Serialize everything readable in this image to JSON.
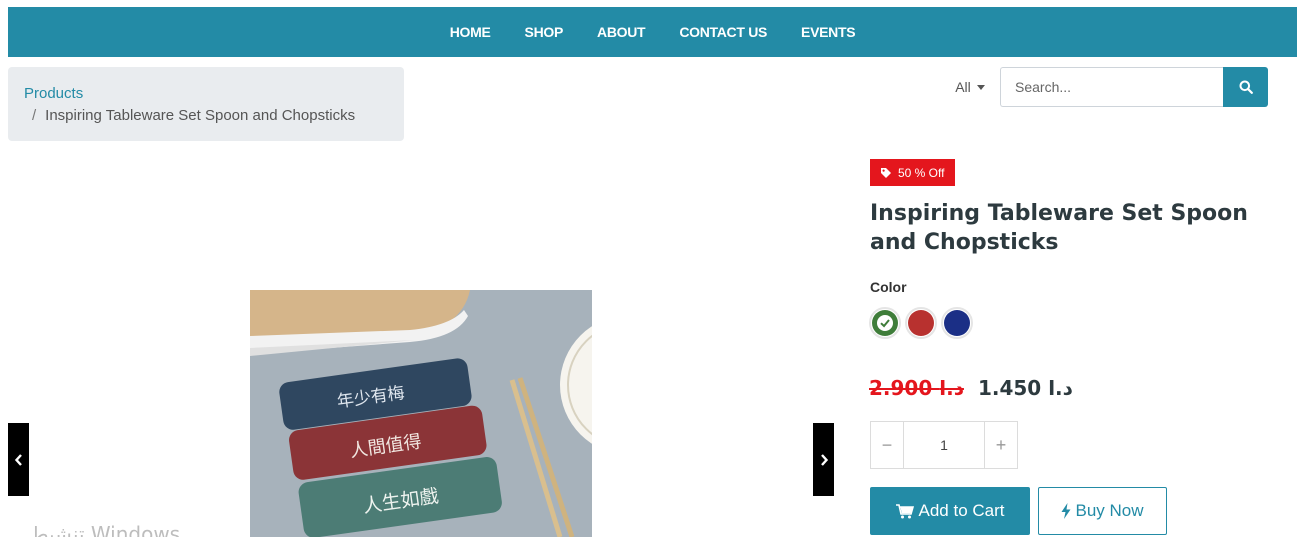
{
  "nav": {
    "items": [
      "HOME",
      "SHOP",
      "ABOUT",
      "CONTACT US",
      "EVENTS"
    ]
  },
  "breadcrumb": {
    "parent": "Products",
    "separator": "/",
    "current": "Inspiring Tableware Set Spoon and Chopsticks"
  },
  "search": {
    "category": "All",
    "placeholder": "Search...",
    "icon": "search-icon"
  },
  "gallery": {
    "prev_icon": "chevron-left-icon",
    "next_icon": "chevron-right-icon",
    "image_texts": [
      "年少有梅",
      "人間值得",
      "人生如戲"
    ],
    "watermark": "تنشيط Windows"
  },
  "product": {
    "discount_badge": "50 % Off",
    "title": "Inspiring Tableware Set Spoon and Chopsticks",
    "color_label": "Color",
    "colors": [
      {
        "hex": "#3f7d3a",
        "selected": true
      },
      {
        "hex": "#b8312f",
        "selected": false
      },
      {
        "hex": "#1b2f86",
        "selected": false
      }
    ],
    "old_price": "2.900 د.ا",
    "new_price": "1.450 د.ا",
    "quantity": "1",
    "qty_minus": "−",
    "qty_plus": "+",
    "add_to_cart": "Add to Cart",
    "buy_now": "Buy Now"
  },
  "theme": {
    "primary": "#238ba6",
    "danger": "#e4161d"
  }
}
